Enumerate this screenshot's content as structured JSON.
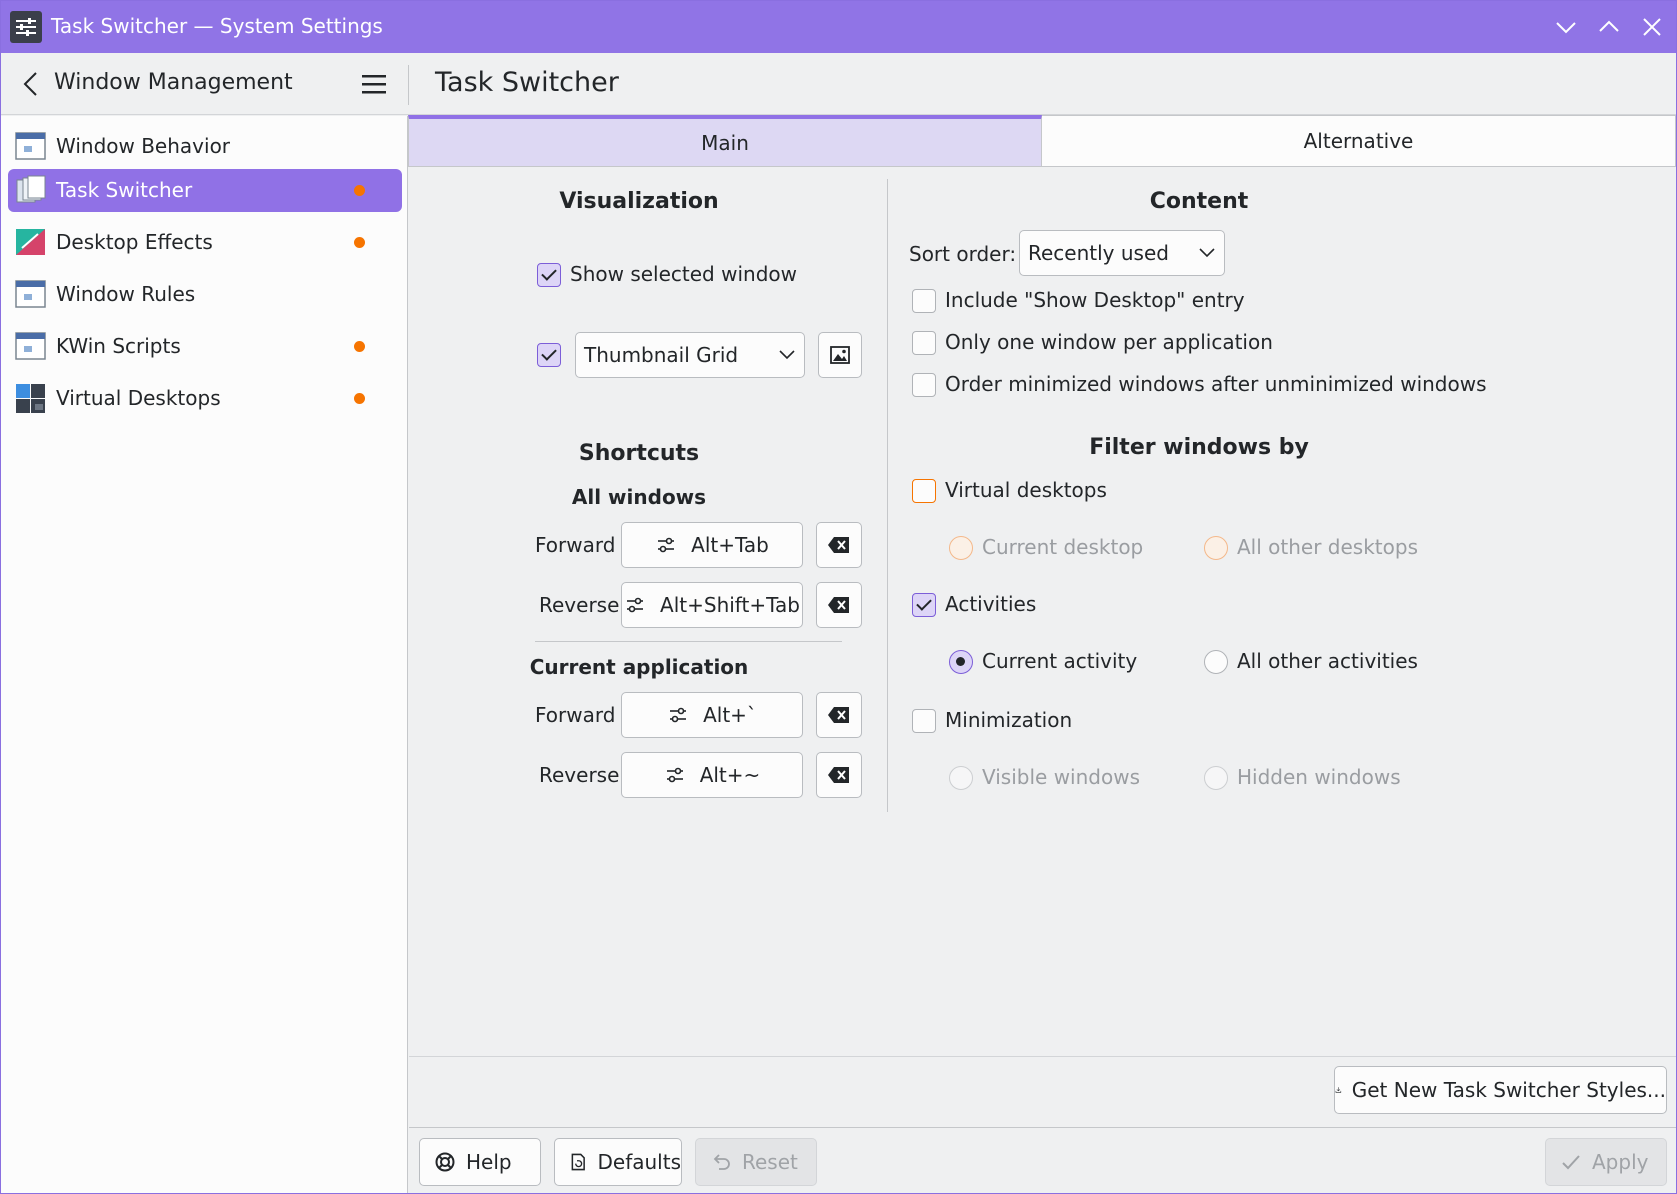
{
  "window": {
    "title": "Task Switcher — System Settings"
  },
  "header": {
    "breadcrumb": "Window Management",
    "page_title": "Task Switcher"
  },
  "sidebar": {
    "items": [
      {
        "label": "Window Behavior",
        "selected": false,
        "modified": false,
        "icon": "window-icon"
      },
      {
        "label": "Task Switcher",
        "selected": true,
        "modified": true,
        "icon": "task-switcher-icon"
      },
      {
        "label": "Desktop Effects",
        "selected": false,
        "modified": true,
        "icon": "desktop-effects-icon"
      },
      {
        "label": "Window Rules",
        "selected": false,
        "modified": false,
        "icon": "window-icon"
      },
      {
        "label": "KWin Scripts",
        "selected": false,
        "modified": true,
        "icon": "window-icon"
      },
      {
        "label": "Virtual Desktops",
        "selected": false,
        "modified": true,
        "icon": "virtual-desktops-icon"
      }
    ]
  },
  "tabs": [
    {
      "label": "Main",
      "active": true
    },
    {
      "label": "Alternative",
      "active": false
    }
  ],
  "visualization": {
    "heading": "Visualization",
    "show_selected_window": {
      "label": "Show selected window",
      "checked": true
    },
    "style_enabled": true,
    "style_value": "Thumbnail Grid"
  },
  "shortcuts": {
    "heading": "Shortcuts",
    "all_windows": {
      "heading": "All windows",
      "forward_label": "Forward",
      "forward_value": "Alt+Tab",
      "reverse_label": "Reverse",
      "reverse_value": "Alt+Shift+Tab"
    },
    "current_application": {
      "heading": "Current application",
      "forward_label": "Forward",
      "forward_value": "Alt+`",
      "reverse_label": "Reverse",
      "reverse_value": "Alt+~"
    }
  },
  "content": {
    "heading": "Content",
    "sort_order_label": "Sort order:",
    "sort_order_value": "Recently used",
    "include_show_desktop": {
      "label": "Include \"Show Desktop\" entry",
      "checked": false
    },
    "one_window_per_app": {
      "label": "Only one window per application",
      "checked": false
    },
    "order_minimized": {
      "label": "Order minimized windows after unminimized windows",
      "checked": false
    }
  },
  "filter": {
    "heading": "Filter windows by",
    "virtual_desktops": {
      "label": "Virtual desktops",
      "checked": false,
      "opt1": "Current desktop",
      "opt2": "All other desktops"
    },
    "activities": {
      "label": "Activities",
      "checked": true,
      "opt1": "Current activity",
      "opt2": "All other activities",
      "selected": "opt1"
    },
    "minimization": {
      "label": "Minimization",
      "checked": false,
      "opt1": "Visible windows",
      "opt2": "Hidden windows"
    }
  },
  "get_new_label": "Get New Task Switcher Styles...",
  "footer": {
    "help": "Help",
    "defaults": "Defaults",
    "reset": "Reset",
    "apply": "Apply"
  },
  "colors": {
    "accent": "#9071e6",
    "modified_dot": "#f67400"
  }
}
